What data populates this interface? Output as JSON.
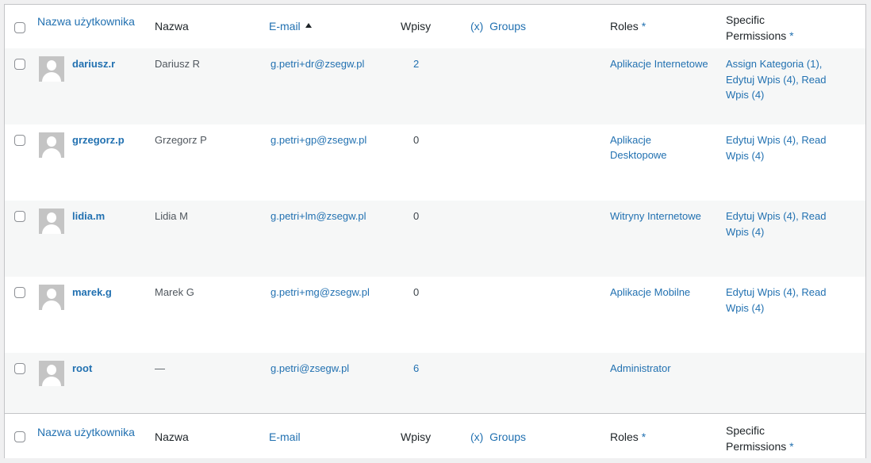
{
  "columns": {
    "username": "Nazwa użytkownika",
    "name": "Nazwa",
    "email": "E-mail",
    "posts": "Wpisy",
    "groups_prefix": "(x)",
    "groups": "Groups",
    "roles": "Roles",
    "roles_marker": "*",
    "specific_line1": "Specific",
    "specific_line2": "Permissions",
    "specific_marker": "*"
  },
  "users": [
    {
      "login": "dariusz.r",
      "name": "Dariusz R",
      "email": "g.petri+dr@zsegw.pl",
      "posts": "2",
      "roles": "Aplikacje Internetowe",
      "permissions": "Assign Kategoria (1), Edytuj Wpis (4), Read Wpis (4)"
    },
    {
      "login": "grzegorz.p",
      "name": "Grzegorz P",
      "email": "g.petri+gp@zsegw.pl",
      "posts": "0",
      "roles": "Aplikacje Desktopowe",
      "permissions": "Edytuj Wpis (4), Read Wpis (4)"
    },
    {
      "login": "lidia.m",
      "name": "Lidia M",
      "email": "g.petri+lm@zsegw.pl",
      "posts": "0",
      "roles": "Witryny Internetowe",
      "permissions": "Edytuj Wpis (4), Read Wpis (4)"
    },
    {
      "login": "marek.g",
      "name": "Marek G",
      "email": "g.petri+mg@zsegw.pl",
      "posts": "0",
      "roles": "Aplikacje Mobilne",
      "permissions": "Edytuj Wpis (4), Read Wpis (4)"
    },
    {
      "login": "root",
      "name": "—",
      "email": "g.petri@zsegw.pl",
      "posts": "6",
      "roles": "Administrator",
      "permissions": ""
    }
  ],
  "colors": {
    "link": "#2271b1",
    "text": "#3c434a",
    "alt_row": "#f6f7f7",
    "border": "#c3c4c7"
  },
  "icons": {
    "avatar": "default-avatar-icon",
    "sort": "sort-ascending-icon"
  }
}
